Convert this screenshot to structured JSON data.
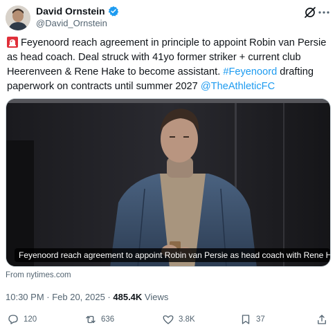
{
  "author": {
    "display_name": "David Ornstein",
    "handle": "@David_Ornstein"
  },
  "icons": {
    "verified": "verified-badge-icon",
    "grok": "grok-icon",
    "more": "more-icon",
    "siren": "siren-emoji"
  },
  "tweet": {
    "text_1": "Feyenoord reach agreement in principle to appoint Robin van Persie as head coach. Deal struck with 41yo former striker + current club Heerenveen & Rene Hake to become assistant. ",
    "hashtag": "#Feyenoord",
    "text_2": " drafting paperwork on contracts until summer 2027 ",
    "mention": "@TheAthleticFC"
  },
  "media": {
    "caption": "Feyenoord reach agreement to appoint Robin van Persie as head coach with Rene Hak...",
    "source": "From nytimes.com"
  },
  "meta": {
    "datetime": "10:30 PM · Feb 20, 2025 · ",
    "views_count": "485.4K",
    "views_label": " Views"
  },
  "actions": {
    "replies": "120",
    "reposts": "636",
    "likes": "3.8K",
    "bookmarks": "37"
  },
  "colors": {
    "link": "#1d9bf0",
    "text": "#0f1419",
    "secondary": "#536471",
    "verified": "#1d9bf0"
  }
}
